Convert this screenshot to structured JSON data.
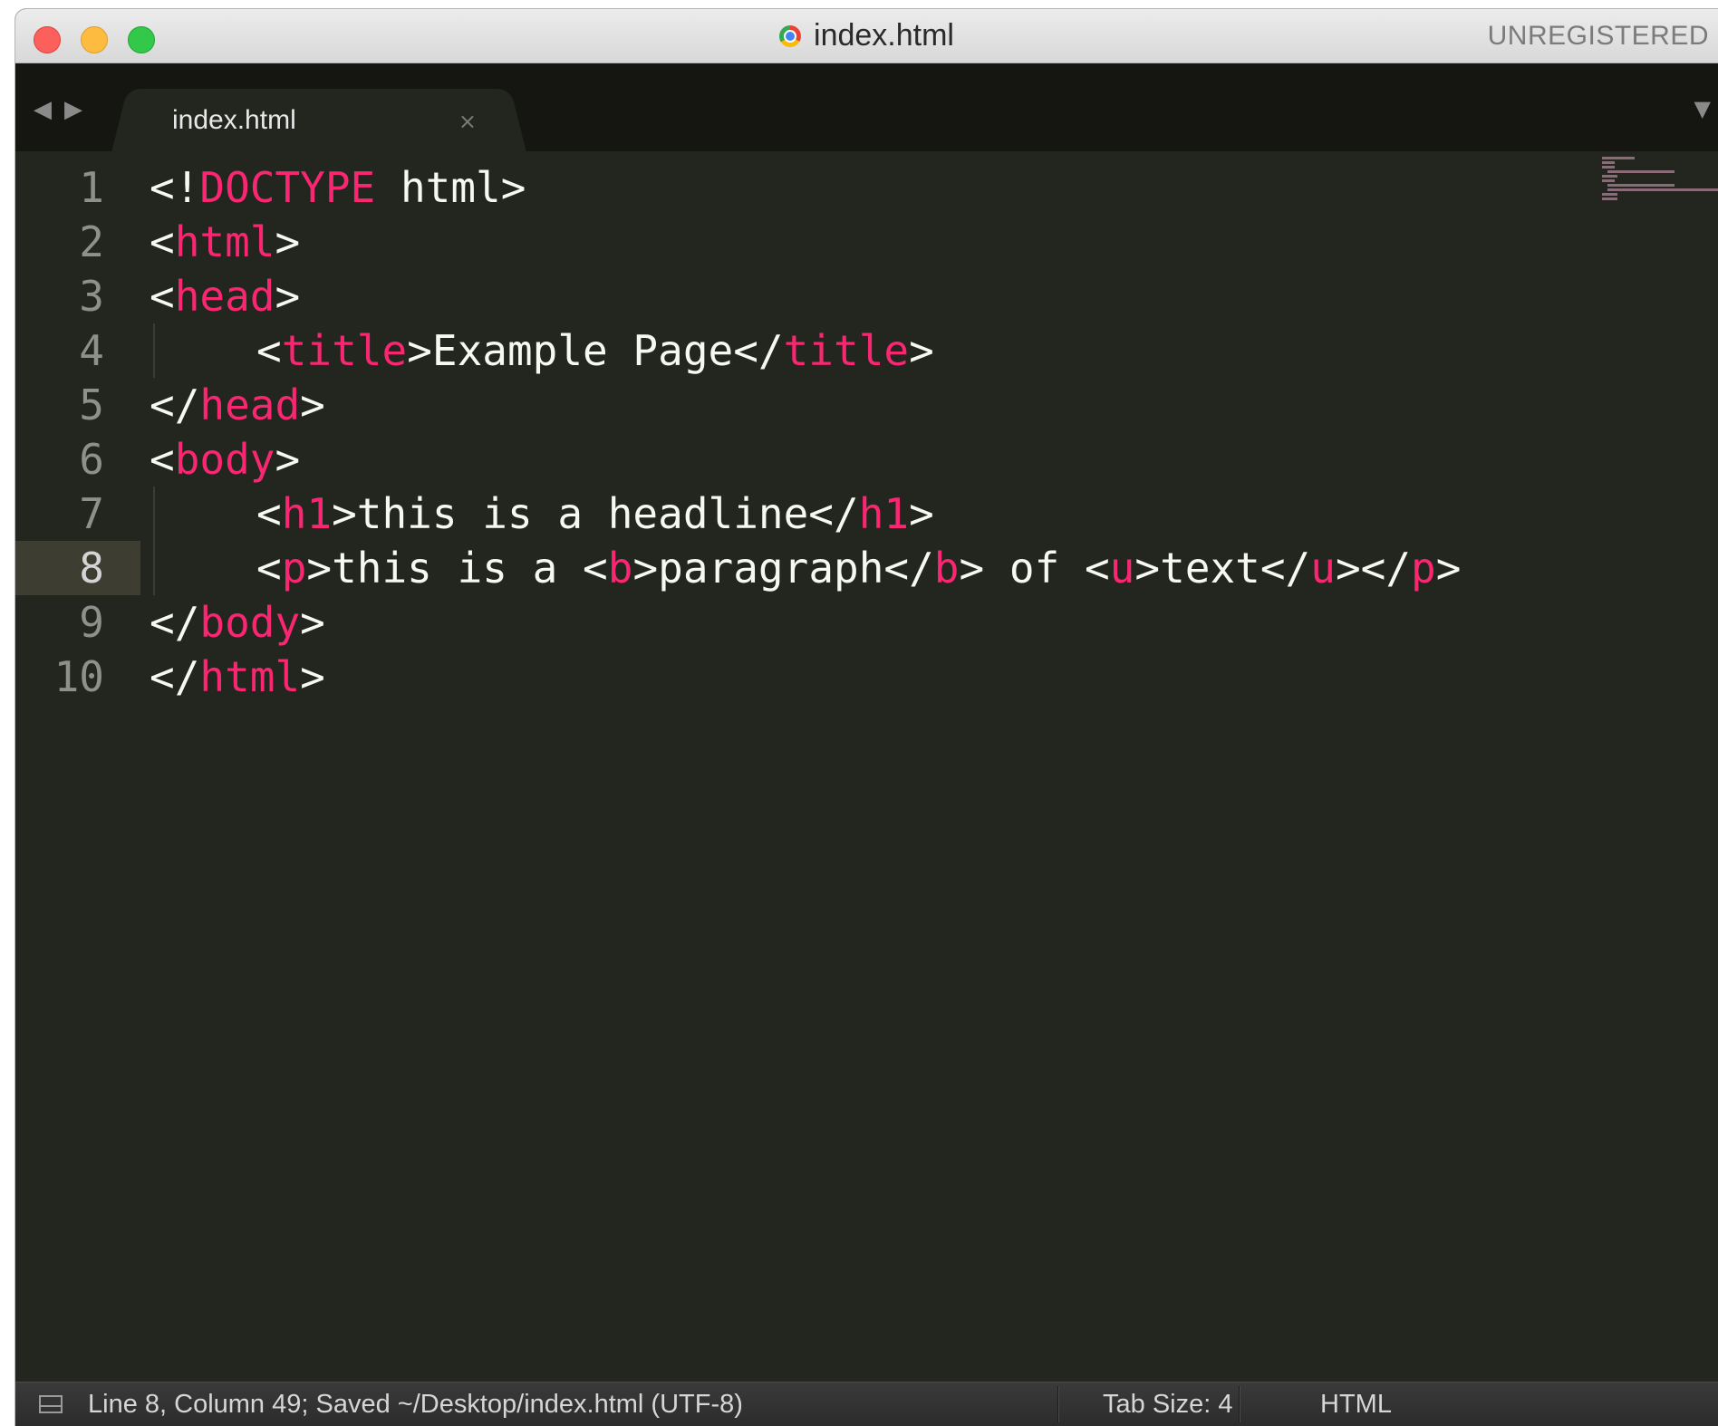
{
  "window": {
    "title": "index.html",
    "license_status": "UNREGISTERED"
  },
  "tab": {
    "label": "index.html",
    "close_glyph": "×"
  },
  "editor": {
    "active_line": 8,
    "lines": [
      {
        "n": "1",
        "indent": false,
        "parts": [
          {
            "t": "<!",
            "c": "p"
          },
          {
            "t": "DOCTYPE",
            "c": "tag"
          },
          {
            "t": " html>",
            "c": "p"
          }
        ]
      },
      {
        "n": "2",
        "indent": false,
        "parts": [
          {
            "t": "<",
            "c": "p"
          },
          {
            "t": "html",
            "c": "tag"
          },
          {
            "t": ">",
            "c": "p"
          }
        ]
      },
      {
        "n": "3",
        "indent": false,
        "parts": [
          {
            "t": "<",
            "c": "p"
          },
          {
            "t": "head",
            "c": "tag"
          },
          {
            "t": ">",
            "c": "p"
          }
        ]
      },
      {
        "n": "4",
        "indent": true,
        "parts": [
          {
            "t": "<",
            "c": "p"
          },
          {
            "t": "title",
            "c": "tag"
          },
          {
            "t": ">Example Page</",
            "c": "p"
          },
          {
            "t": "title",
            "c": "tag"
          },
          {
            "t": ">",
            "c": "p"
          }
        ]
      },
      {
        "n": "5",
        "indent": false,
        "parts": [
          {
            "t": "</",
            "c": "p"
          },
          {
            "t": "head",
            "c": "tag"
          },
          {
            "t": ">",
            "c": "p"
          }
        ]
      },
      {
        "n": "6",
        "indent": false,
        "parts": [
          {
            "t": "<",
            "c": "p"
          },
          {
            "t": "body",
            "c": "tag"
          },
          {
            "t": ">",
            "c": "p"
          }
        ]
      },
      {
        "n": "7",
        "indent": true,
        "parts": [
          {
            "t": "<",
            "c": "p"
          },
          {
            "t": "h1",
            "c": "tag"
          },
          {
            "t": ">this is a headline</",
            "c": "p"
          },
          {
            "t": "h1",
            "c": "tag"
          },
          {
            "t": ">",
            "c": "p"
          }
        ]
      },
      {
        "n": "8",
        "indent": true,
        "parts": [
          {
            "t": "<",
            "c": "p"
          },
          {
            "t": "p",
            "c": "tag"
          },
          {
            "t": ">this is a <",
            "c": "p"
          },
          {
            "t": "b",
            "c": "tag"
          },
          {
            "t": ">paragraph</",
            "c": "p"
          },
          {
            "t": "b",
            "c": "tag"
          },
          {
            "t": "> of <",
            "c": "p"
          },
          {
            "t": "u",
            "c": "tag"
          },
          {
            "t": ">text</",
            "c": "p"
          },
          {
            "t": "u",
            "c": "tag"
          },
          {
            "t": "></",
            "c": "p"
          },
          {
            "t": "p",
            "c": "tag"
          },
          {
            "t": ">",
            "c": "p"
          }
        ]
      },
      {
        "n": "9",
        "indent": false,
        "parts": [
          {
            "t": "</",
            "c": "p"
          },
          {
            "t": "body",
            "c": "tag"
          },
          {
            "t": ">",
            "c": "p"
          }
        ]
      },
      {
        "n": "10",
        "indent": false,
        "parts": [
          {
            "t": "</",
            "c": "p"
          },
          {
            "t": "html",
            "c": "tag"
          },
          {
            "t": ">",
            "c": "p"
          }
        ]
      }
    ]
  },
  "statusbar": {
    "position_text": "Line 8, Column 49; Saved ~/Desktop/index.html (UTF-8)",
    "tab_size": "Tab Size: 4",
    "syntax": "HTML"
  },
  "colors": {
    "editor_bg": "#22261f",
    "tag": "#f92672",
    "plain": "#f8f8f2",
    "gutter_text": "#8f908a"
  },
  "icons": {
    "back": "left-arrow-icon",
    "forward": "right-arrow-icon",
    "tab_dropdown": "chevron-down-icon",
    "panel": "panel-toggle-icon",
    "file": "chrome-file-icon"
  }
}
